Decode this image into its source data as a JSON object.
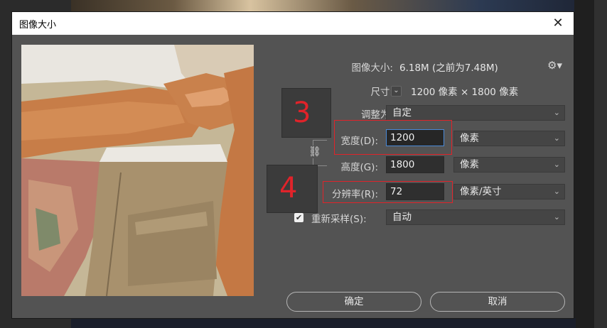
{
  "dialog": {
    "title": "图像大小",
    "close_glyph": "✕"
  },
  "image_size": {
    "label": "图像大小:",
    "value": "6.18M (之前为7.48M)"
  },
  "dimensions": {
    "label": "尺寸:",
    "value": "1200 像素 × 1800 像素"
  },
  "fit_to": {
    "label": "调整为:",
    "value": "自定"
  },
  "width": {
    "label": "宽度(D):",
    "value": "1200",
    "unit": "像素"
  },
  "height": {
    "label": "高度(G):",
    "value": "1800",
    "unit": "像素"
  },
  "resolution": {
    "label": "分辨率(R):",
    "value": "72",
    "unit": "像素/英寸"
  },
  "resample": {
    "label": "重新采样(S):",
    "checked": true,
    "value": "自动"
  },
  "annotations": {
    "step3": "3",
    "step4": "4"
  },
  "buttons": {
    "ok": "确定",
    "cancel": "取消"
  },
  "icons": {
    "settings": "gear-icon",
    "constrain": "link-icon",
    "chevron": "chevron-down-icon"
  },
  "colors": {
    "dialog_bg": "#535353",
    "highlight": "#e0232a",
    "focus": "#4a8ad8"
  }
}
